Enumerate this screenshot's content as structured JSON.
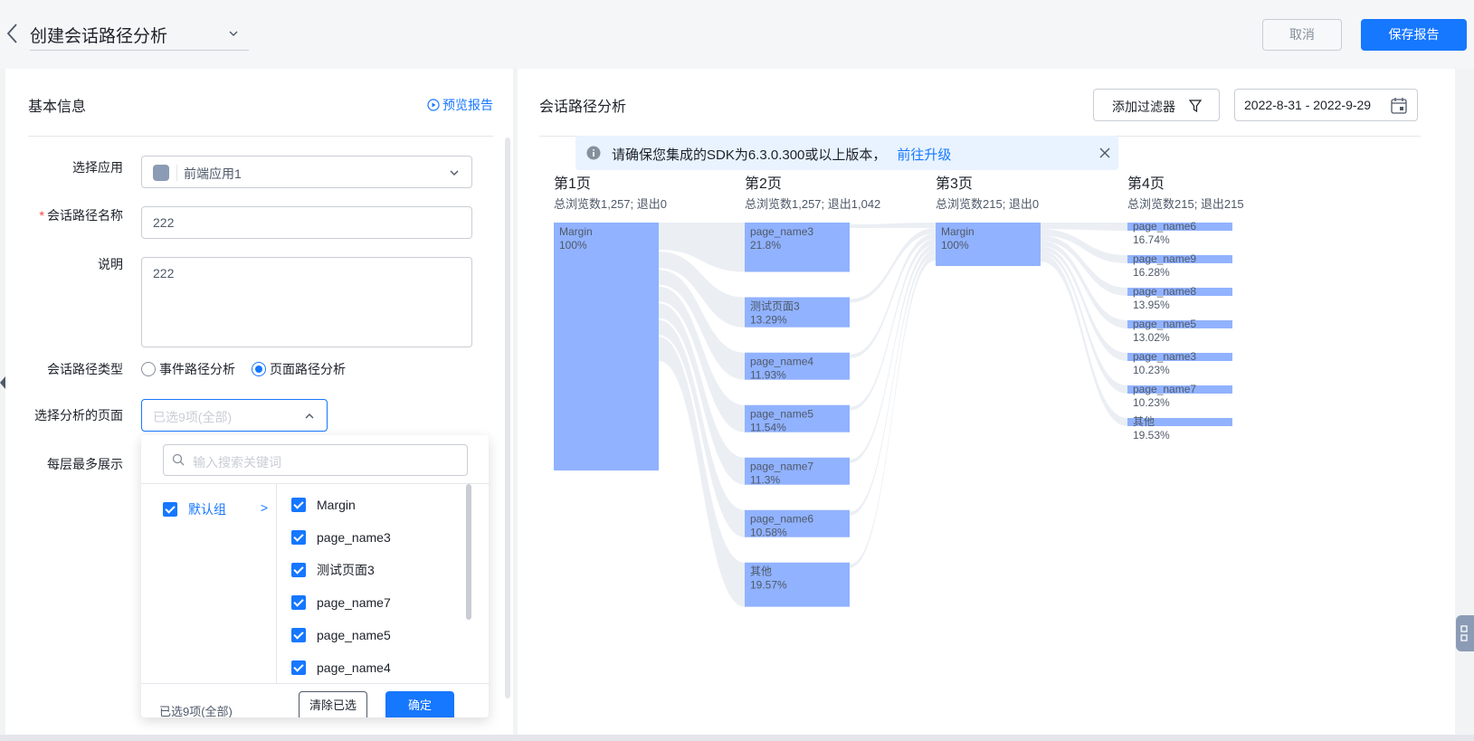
{
  "header": {
    "title": "创建会话路径分析",
    "cancel_label": "取消",
    "save_label": "保存报告"
  },
  "left": {
    "section_title": "基本信息",
    "preview_label": "预览报告",
    "labels": {
      "app": "选择应用",
      "name": "会话路径名称",
      "desc": "说明",
      "type": "会话路径类型",
      "pages": "选择分析的页面",
      "max": "每层最多展示"
    },
    "required_mark": "*",
    "app_value": "前端应用1",
    "name_value": "222",
    "desc_value": "222",
    "type_options": [
      "事件路径分析",
      "页面路径分析"
    ],
    "type_selected": "页面路径分析",
    "pages_placeholder": "已选9项(全部)"
  },
  "dropdown": {
    "search_placeholder": "输入搜索关键词",
    "group_label": "默认组",
    "group_arrow": ">",
    "items": [
      "Margin",
      "page_name3",
      "测试页面3",
      "page_name7",
      "page_name5",
      "page_name4"
    ],
    "count_text": "已选9项(全部)",
    "clear_label": "清除已选",
    "ok_label": "确定"
  },
  "right": {
    "title": "会话路径分析",
    "filter_label": "添加过滤器",
    "date_range": "2022-8-31 - 2022-9-29",
    "alert_text": "请确保您集成的SDK为6.3.0.300或以上版本，",
    "alert_link": "前往升级"
  },
  "chart_data": {
    "type": "sankey",
    "columns": [
      {
        "title": "第1页",
        "summary": "总浏览数1,257; 退出0",
        "nodes": [
          {
            "name": "Margin",
            "pct": "100%",
            "share": 1.0
          }
        ]
      },
      {
        "title": "第2页",
        "summary": "总浏览数1,257; 退出1,042",
        "nodes": [
          {
            "name": "page_name3",
            "pct": "21.8%",
            "share": 0.218
          },
          {
            "name": "测试页面3",
            "pct": "13.29%",
            "share": 0.1329
          },
          {
            "name": "page_name4",
            "pct": "11.93%",
            "share": 0.1193
          },
          {
            "name": "page_name5",
            "pct": "11.54%",
            "share": 0.1154
          },
          {
            "name": "page_name7",
            "pct": "11.3%",
            "share": 0.113
          },
          {
            "name": "page_name6",
            "pct": "10.58%",
            "share": 0.1058
          },
          {
            "name": "其他",
            "pct": "19.57%",
            "share": 0.1957
          }
        ]
      },
      {
        "title": "第3页",
        "summary": "总浏览数215; 退出0",
        "nodes": [
          {
            "name": "Margin",
            "pct": "100%",
            "share": 1.0
          }
        ]
      },
      {
        "title": "第4页",
        "summary": "总浏览数215; 退出215",
        "nodes": [
          {
            "name": "page_name6",
            "pct": "16.74%",
            "share": 0.1674
          },
          {
            "name": "page_name9",
            "pct": "16.28%",
            "share": 0.1628
          },
          {
            "name": "page_name8",
            "pct": "13.95%",
            "share": 0.1395
          },
          {
            "name": "page_name5",
            "pct": "13.02%",
            "share": 0.1302
          },
          {
            "name": "page_name3",
            "pct": "10.23%",
            "share": 0.1023
          },
          {
            "name": "page_name7",
            "pct": "10.23%",
            "share": 0.1023
          },
          {
            "name": "其他",
            "pct": "19.53%",
            "share": 0.1953
          }
        ]
      }
    ],
    "colors": {
      "node": "#91b2ff",
      "link": "#e8ecf2",
      "text": "#1d2129",
      "subtext": "#4e5969"
    }
  }
}
